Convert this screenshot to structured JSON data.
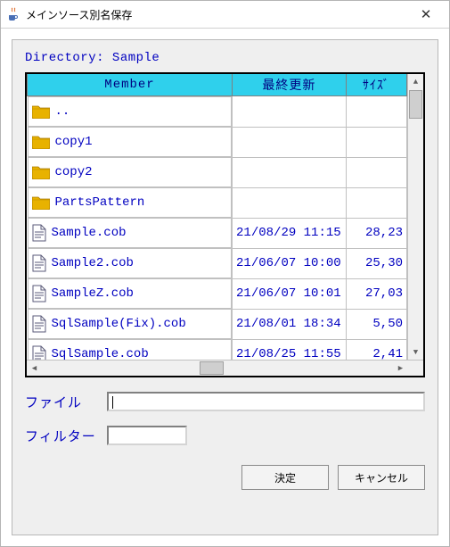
{
  "window": {
    "title": "メインソース別名保存",
    "close_glyph": "✕"
  },
  "directory_label": "Directory: Sample",
  "columns": {
    "member": "Member",
    "updated": "最終更新",
    "size": "ｻｲｽﾞ"
  },
  "rows": [
    {
      "type": "folder",
      "name": "..",
      "updated": "",
      "size": ""
    },
    {
      "type": "folder",
      "name": "copy1",
      "updated": "",
      "size": ""
    },
    {
      "type": "folder",
      "name": "copy2",
      "updated": "",
      "size": ""
    },
    {
      "type": "folder",
      "name": "PartsPattern",
      "updated": "",
      "size": ""
    },
    {
      "type": "file",
      "name": "Sample.cob",
      "updated": "21/08/29 11:15",
      "size": "28,23"
    },
    {
      "type": "file",
      "name": "Sample2.cob",
      "updated": "21/06/07 10:00",
      "size": "25,30"
    },
    {
      "type": "file",
      "name": "SampleZ.cob",
      "updated": "21/06/07 10:01",
      "size": "27,03"
    },
    {
      "type": "file",
      "name": "SqlSample(Fix).cob",
      "updated": "21/08/01 18:34",
      "size": "5,50"
    },
    {
      "type": "file",
      "name": "SqlSample.cob",
      "updated": "21/08/25 11:55",
      "size": "2,41"
    }
  ],
  "labels": {
    "file": "ファイル",
    "filter": "フィルター"
  },
  "inputs": {
    "file_value": "",
    "filter_value": ""
  },
  "buttons": {
    "ok": "決定",
    "cancel": "キャンセル"
  }
}
